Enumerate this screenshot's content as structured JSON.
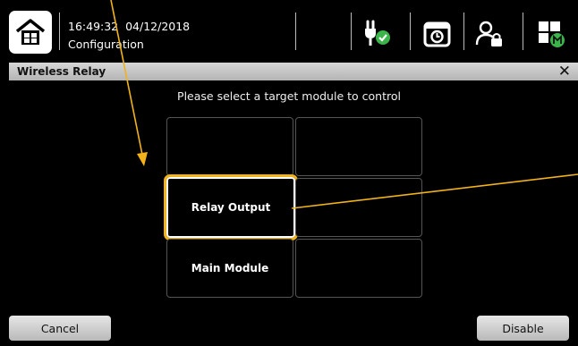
{
  "header": {
    "time": "16:49:32",
    "date": "04/12/2018",
    "subtitle": "Configuration"
  },
  "icons": [
    "home-icon",
    "power-plug-check-icon",
    "alarm-clock-icon",
    "user-lock-icon",
    "main-module-grid-icon"
  ],
  "dialog": {
    "title": "Wireless Relay",
    "prompt": "Please select a target module to control",
    "grid": [
      [
        "",
        ""
      ],
      [
        "Relay Output",
        ""
      ],
      [
        "Main Module",
        ""
      ]
    ],
    "selected": "Relay Output",
    "cancel_label": "Cancel",
    "disable_label": "Disable"
  },
  "colors": {
    "highlight": "#f2b21a",
    "status_green": "#3bb54a",
    "background": "#000000"
  }
}
